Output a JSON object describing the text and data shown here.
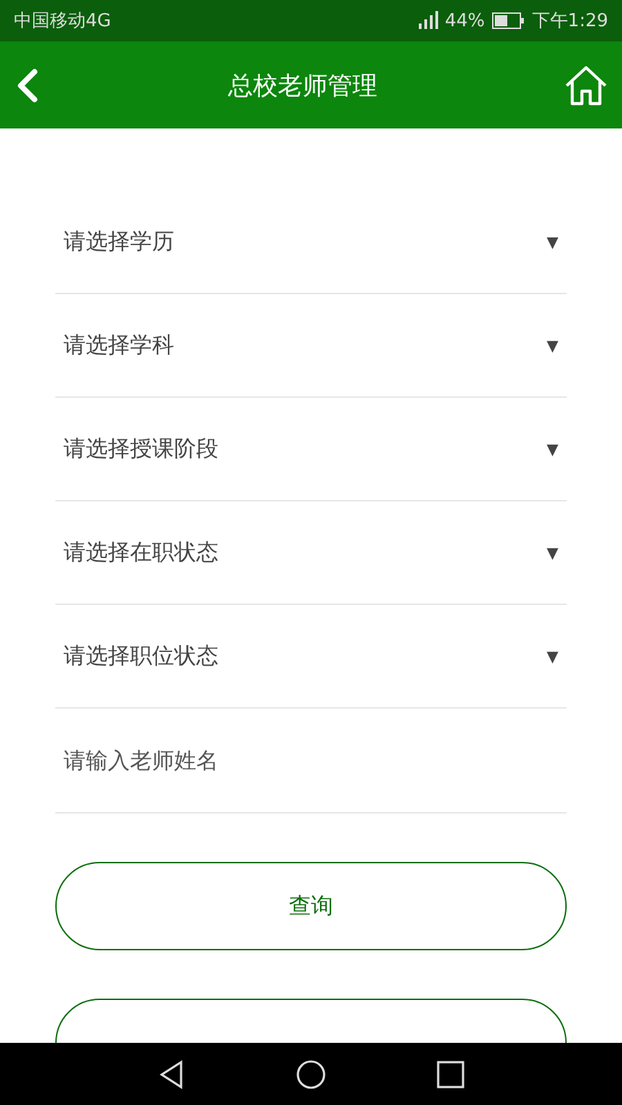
{
  "status_bar": {
    "carrier": "中国移动4G",
    "battery_text": "44%",
    "time": "下午1:29"
  },
  "header": {
    "title": "总校老师管理"
  },
  "filters": [
    {
      "placeholder": "请选择学历",
      "caret": "▼"
    },
    {
      "placeholder": "请选择学科",
      "caret": "▼"
    },
    {
      "placeholder": "请选择授课阶段",
      "caret": "▼"
    },
    {
      "placeholder": "请选择在职状态",
      "caret": "▼"
    },
    {
      "placeholder": "请选择职位状态",
      "caret": "▼"
    }
  ],
  "name_field": {
    "placeholder": "请输入老师姓名"
  },
  "buttons": [
    "查询"
  ]
}
